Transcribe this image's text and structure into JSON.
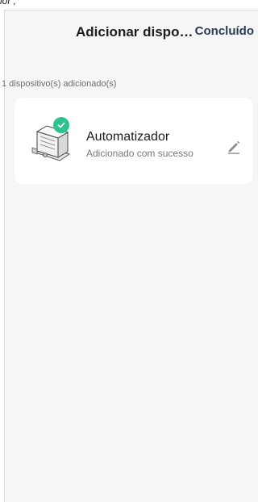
{
  "top_fragment": "lor ;",
  "header": {
    "title": "Adicionar dispositi...",
    "done_label": "Concluído"
  },
  "devices_section": {
    "count_label": "1 dispositivo(s) adicionado(s)"
  },
  "device": {
    "name": "Automatizador",
    "status": "Adicionado com sucesso",
    "icon": "gate-motor-image",
    "status_icon": "check-icon",
    "edit_icon": "pencil-icon"
  },
  "colors": {
    "accent": "#2b3a55",
    "success": "#2cc391",
    "background": "#f6f6f7",
    "card": "#ffffff"
  }
}
